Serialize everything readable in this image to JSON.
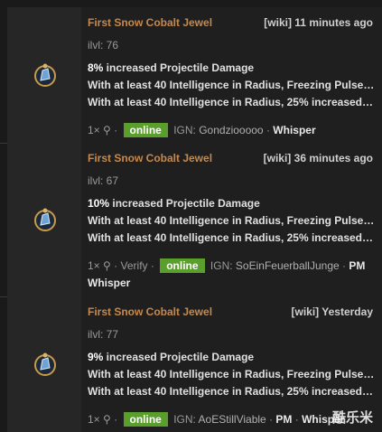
{
  "listings": [
    {
      "name": "First Snow Cobalt Jewel",
      "wiki": "[wiki]",
      "time": "11 minutes ago",
      "ilvl": "ilvl: 76",
      "mod1_value": "8%",
      "mod1_rest": " increased Projectile Damage",
      "mod2": "With at least 40 Intelligence in Radius, Freezing Pulse fi…",
      "mod3": "With at least 40 Intelligence in Radius, 25% increased F…",
      "qty": "1×",
      "verify": "",
      "status": "online",
      "ign_label": "IGN:",
      "ign": "Gondziooooo",
      "pm": "",
      "whisper": "Whisper"
    },
    {
      "name": "First Snow Cobalt Jewel",
      "wiki": "[wiki]",
      "time": "36 minutes ago",
      "ilvl": "ilvl: 67",
      "mod1_value": "10%",
      "mod1_rest": " increased Projectile Damage",
      "mod2": "With at least 40 Intelligence in Radius, Freezing Pulse fi…",
      "mod3": "With at least 40 Intelligence in Radius, 25% increased F…",
      "qty": "1×",
      "verify": "Verify",
      "status": "online",
      "ign_label": "IGN:",
      "ign": "SoEinFeuerballJunge",
      "pm": "PM",
      "whisper": "Whisper"
    },
    {
      "name": "First Snow Cobalt Jewel",
      "wiki": "[wiki]",
      "time": "Yesterday",
      "ilvl": "ilvl: 77",
      "mod1_value": "9%",
      "mod1_rest": " increased Projectile Damage",
      "mod2": "With at least 40 Intelligence in Radius, Freezing Pulse fi…",
      "mod3": "With at least 40 Intelligence in Radius, 25% increased F…",
      "qty": "1×",
      "verify": "",
      "status": "online",
      "ign_label": "IGN:",
      "ign": "AoEStillViable",
      "pm": "PM",
      "whisper": "Whisper"
    }
  ],
  "watermark": "酷乐米"
}
